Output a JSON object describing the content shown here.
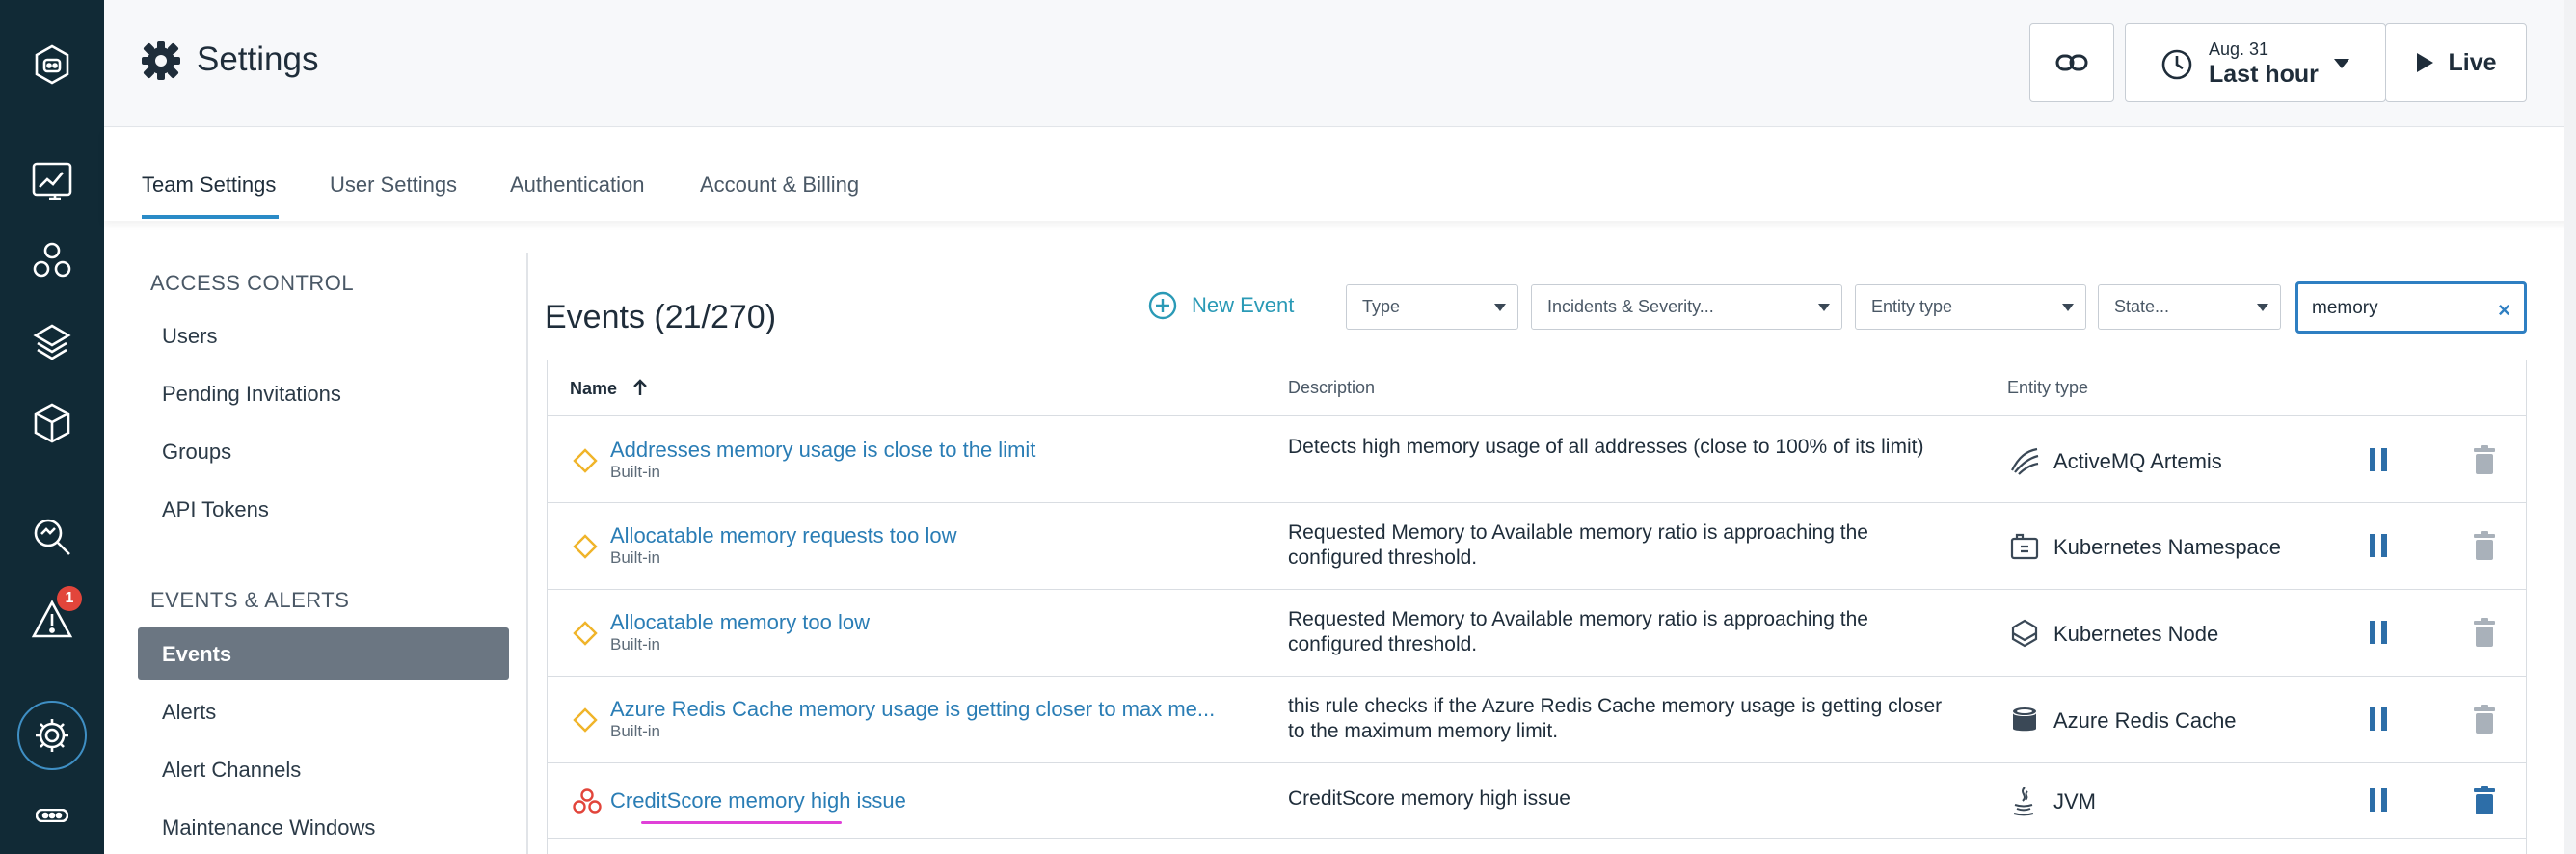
{
  "header": {
    "title": "Settings",
    "time_date": "Aug. 31",
    "time_range": "Last hour",
    "live_label": "Live"
  },
  "tabs": [
    {
      "label": "Team Settings",
      "active": true
    },
    {
      "label": "User Settings",
      "active": false
    },
    {
      "label": "Authentication",
      "active": false
    },
    {
      "label": "Account & Billing",
      "active": false
    }
  ],
  "sidebar": {
    "access_control": {
      "heading": "ACCESS CONTROL",
      "items": [
        "Users",
        "Pending Invitations",
        "Groups",
        "API Tokens"
      ]
    },
    "events_alerts": {
      "heading": "EVENTS & ALERTS",
      "items": [
        "Events",
        "Alerts",
        "Alert Channels",
        "Maintenance Windows"
      ],
      "active": "Events"
    }
  },
  "rail": {
    "alert_badge": "1"
  },
  "events": {
    "title": "Events (21/270)",
    "new_event_label": "New Event",
    "filters": {
      "type": "Type",
      "severity": "Incidents & Severity...",
      "entity_type": "Entity type",
      "state": "State..."
    },
    "search_value": "memory",
    "columns": {
      "name": "Name",
      "description": "Description",
      "entity_type": "Entity type"
    },
    "rows": [
      {
        "name": "Addresses memory usage is close to the limit",
        "builtin": "Built-in",
        "description": "Detects high memory usage of all addresses (close to 100% of its limit)",
        "entity_type": "ActiveMQ Artemis",
        "entity_icon": "artemis-icon",
        "status_color": "#f0b429"
      },
      {
        "name": "Allocatable memory requests too low",
        "builtin": "Built-in",
        "description": "Requested Memory to Available memory ratio is approaching the configured threshold.",
        "entity_type": "Kubernetes Namespace",
        "entity_icon": "namespace-icon",
        "status_color": "#f0b429"
      },
      {
        "name": "Allocatable memory too low",
        "builtin": "Built-in",
        "description": "Requested Memory to Available memory ratio is approaching the configured threshold.",
        "entity_type": "Kubernetes Node",
        "entity_icon": "node-icon",
        "status_color": "#f0b429"
      },
      {
        "name": "Azure Redis Cache memory usage is getting closer to max me...",
        "builtin": "Built-in",
        "description": "this rule checks if the Azure Redis Cache memory usage is getting closer to the maximum memory limit.",
        "entity_type": "Azure Redis Cache",
        "entity_icon": "redis-icon",
        "status_color": "#f0b429"
      },
      {
        "name": "CreditScore memory high issue",
        "builtin": "",
        "description": "CreditScore memory high issue",
        "entity_type": "JVM",
        "entity_icon": "java-icon",
        "status_color": "#e2453b"
      }
    ]
  },
  "colors": {
    "rail_bg": "#112a36",
    "accent": "#2a8bc7",
    "link": "#2a7db5",
    "warning": "#f0b429",
    "critical": "#e2453b",
    "annotation": "#e040d8"
  }
}
